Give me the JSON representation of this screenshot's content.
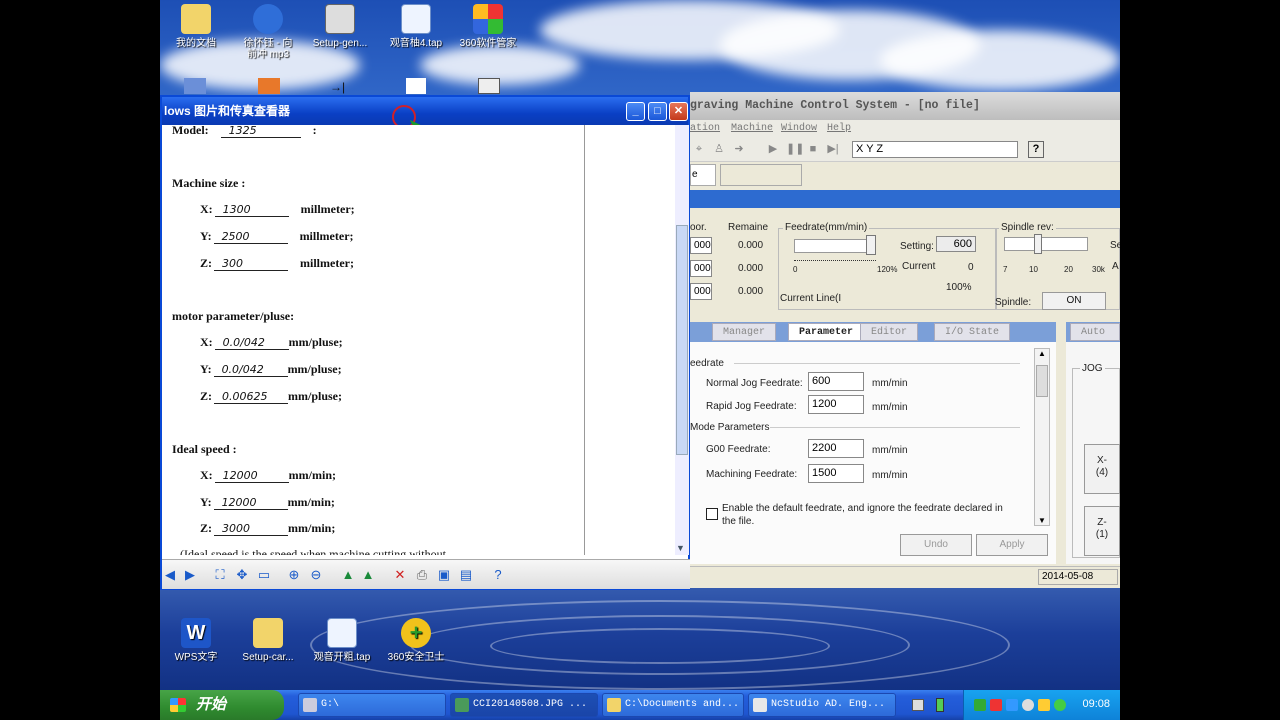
{
  "desktop": {
    "top_icons": [
      {
        "label": "我的文档",
        "sub": ""
      },
      {
        "label": "徐怀钰 - 向",
        "sub": "前冲 mp3"
      },
      {
        "label": "Setup-gen...",
        "sub": ""
      },
      {
        "label": "观音柚4.tap",
        "sub": ""
      },
      {
        "label": "360软件管家",
        "sub": ""
      }
    ],
    "bottom_icons": [
      {
        "label": "WPS文字"
      },
      {
        "label": "Setup-car..."
      },
      {
        "label": "观音开粗.tap"
      },
      {
        "label": "360安全卫士"
      }
    ]
  },
  "viewer": {
    "title": "lows 图片和传真查看器",
    "doc": {
      "model_label": "Model:",
      "model_value": "1325",
      "size_heading": "Machine size :",
      "size_rows": [
        {
          "axis": "X:",
          "value": "1300",
          "unit": "millmeter;"
        },
        {
          "axis": "Y:",
          "value": "2500",
          "unit": "millmeter;"
        },
        {
          "axis": "Z:",
          "value": "300",
          "unit": "millmeter;"
        }
      ],
      "motor_heading": "motor parameter/pluse:",
      "motor_rows": [
        {
          "axis": "X:",
          "value": "0.0/042",
          "unit": "mm/pluse;"
        },
        {
          "axis": "Y:",
          "value": "0.0/042",
          "unit": "mm/pluse;"
        },
        {
          "axis": "Z:",
          "value": "0.00625",
          "unit": "mm/pluse;"
        }
      ],
      "speed_heading": "Ideal   speed  :",
      "speed_rows": [
        {
          "axis": "X:",
          "value": "12000",
          "unit": "mm/min;"
        },
        {
          "axis": "Y:",
          "value": "12000",
          "unit": "mm/min;"
        },
        {
          "axis": "Z:",
          "value": "3000",
          "unit": "mm/min;"
        }
      ],
      "footer_cut": "(Ideal speed is the speed when machine cutting without"
    }
  },
  "ncstudio": {
    "title": "graving Machine Control System  - [no file]",
    "menus": [
      "ation",
      "Machine",
      "Window",
      "Help"
    ],
    "coord_header": "X       Y       Z",
    "coords": {
      "col1_label": "oor.",
      "col2_label": "Remaine",
      "rows": [
        {
          "c1": "000",
          "c2": "0.000"
        },
        {
          "c1": "000",
          "c2": "0.000"
        },
        {
          "c1": "000",
          "c2": "0.000"
        }
      ]
    },
    "feedrate": {
      "label": "Feedrate(mm/min)",
      "scale_min": "0",
      "scale_max": "120%",
      "setting_label": "Setting:",
      "setting_value": "600",
      "current_label": "Current",
      "current_value": "0",
      "percent": "100%",
      "current_line": "Current Line(I"
    },
    "spindle": {
      "label": "Spindle rev:",
      "ticks": [
        "7",
        "10",
        "20",
        "30k"
      ],
      "side_s": "Se",
      "side_a": "A",
      "spindle_label": "Spindle:",
      "on_button": "ON"
    },
    "tabs": [
      "Manager",
      "Parameter",
      "Editor",
      "I/O State"
    ],
    "right_tab": "Auto",
    "params": {
      "group1": "eedrate",
      "normal_label": "Normal Jog Feedrate:",
      "normal_value": "600",
      "rapid_label": "Rapid Jog Feedrate:",
      "rapid_value": "1200",
      "group2": "Mode Parameters",
      "g00_label": "G00 Feedrate:",
      "g00_value": "2200",
      "mach_label": "Machining Feedrate:",
      "mach_value": "1500",
      "unit": "mm/min",
      "checkbox_text": "Enable the default feedrate, and ignore the feedrate declared in the file.",
      "undo": "Undo",
      "apply": "Apply"
    },
    "jog": {
      "label": "JOG",
      "xm": "X-",
      "xm_key": "(4)",
      "zm": "Z-",
      "zm_key": "(1)"
    },
    "status_date": "2014-05-08"
  },
  "taskbar": {
    "start": "开始",
    "tasks": [
      "G:\\",
      "CCI20140508.JPG ...",
      "C:\\Documents and...",
      "NcStudio AD. Eng..."
    ],
    "clock": "09:08"
  }
}
